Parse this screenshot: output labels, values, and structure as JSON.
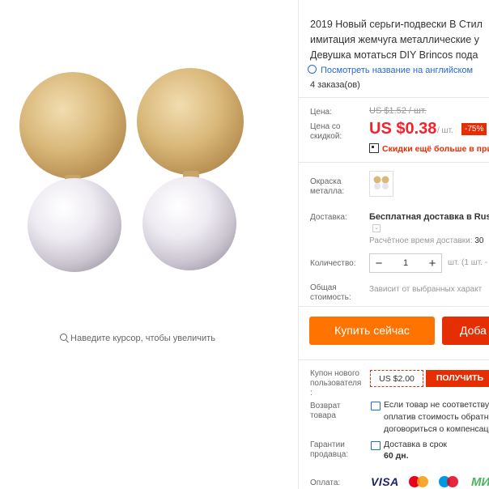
{
  "product": {
    "zoom_hint": "Наведите курсор, чтобы увеличить",
    "title_lines": [
      "2019 Новый серьги-подвески В Стил",
      "имитация жемчуга металлические у",
      "Девушка мотаться DIY Brincos пода"
    ],
    "translate_link": "Посмотреть название на английском",
    "orders": "4 заказа(ов)"
  },
  "pricing": {
    "price_label": "Цена:",
    "old_price": "US $1.52 / шт.",
    "discount_label_lines": [
      "Цена со",
      "скидкой:"
    ],
    "new_price": "US $0.38",
    "per_unit": "/ шт.",
    "discount_badge": "-75%",
    "promo_text": "Скидки ещё больше в при"
  },
  "options": {
    "color_label_lines": [
      "Окраска",
      "металла:"
    ],
    "shipping_label": "Доставка:",
    "shipping_value": "Бесплатная доставка в Russ",
    "estimate_text": "Расчётное время доставки:",
    "estimate_value": "30",
    "qty_label": "Количество:",
    "qty_value": "1",
    "qty_minus": "−",
    "qty_plus": "+",
    "qty_note": "шт. (1 шт. -",
    "total_label_lines": [
      "Общая",
      "стоимость:"
    ],
    "total_value": "Зависит от выбранных характ"
  },
  "actions": {
    "buy_now": "Купить сейчас",
    "add_to_cart": "Доба"
  },
  "services": {
    "coupon_label_lines": [
      "Купон нового",
      "пользователя",
      ":"
    ],
    "coupon_amount": "US $2.00",
    "coupon_button": "ПОЛУЧИТЬ",
    "return_label_lines": [
      "Возврат",
      "товара"
    ],
    "return_lines": [
      "Если товар не соответству",
      "оплатив стоимость обратн",
      "договориться о компенсац"
    ],
    "guarantee_label_lines": [
      "Гарантии",
      "продавца:"
    ],
    "guarantee_text": "Доставка в срок",
    "guarantee_days": "60 дн.",
    "payment_label": "Оплата:",
    "payment_methods": [
      "VISA",
      "MasterCard",
      "Maestro",
      "МИ"
    ]
  },
  "colors": {
    "price_red": "#f5222d",
    "buy_orange": "#ff7300",
    "cart_red": "#e62e04",
    "link_blue": "#2a69c9"
  }
}
